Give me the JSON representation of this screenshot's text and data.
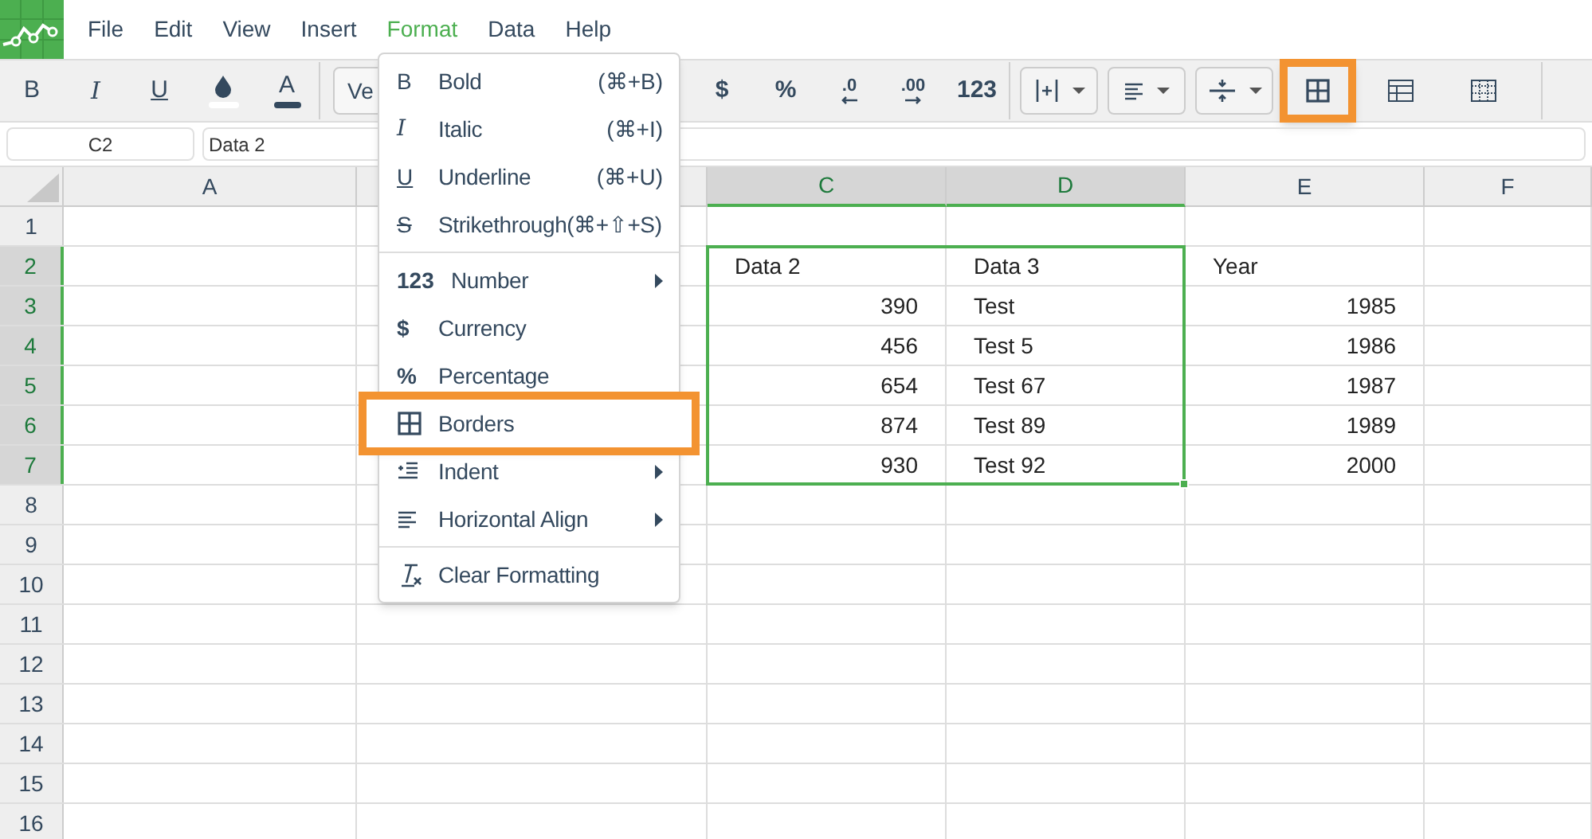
{
  "menu_bar": {
    "items": [
      {
        "label": "File",
        "selected": false
      },
      {
        "label": "Edit",
        "selected": false
      },
      {
        "label": "View",
        "selected": false
      },
      {
        "label": "Insert",
        "selected": false
      },
      {
        "label": "Format",
        "selected": true
      },
      {
        "label": "Data",
        "selected": false
      },
      {
        "label": "Help",
        "selected": false
      }
    ]
  },
  "toolbar": {
    "items": [
      {
        "kind": "bold",
        "label": "B"
      },
      {
        "kind": "italic",
        "label": "I"
      },
      {
        "kind": "underline",
        "label": "U"
      },
      {
        "kind": "fill"
      },
      {
        "kind": "color",
        "label": "A"
      },
      {
        "kind": "select",
        "value": "Ve"
      },
      {
        "kind": "symbol",
        "label": "$"
      },
      {
        "kind": "symbol",
        "label": "%"
      },
      {
        "kind": "decrease",
        "label": ".0"
      },
      {
        "kind": "increase",
        "label": ".00"
      },
      {
        "kind": "symbol",
        "label": "123"
      },
      {
        "kind": "valign"
      },
      {
        "kind": "halign"
      },
      {
        "kind": "split"
      },
      {
        "kind": "borders",
        "highlighted": true
      },
      {
        "kind": "table",
        "highlighted": false
      },
      {
        "kind": "dotted",
        "highlighted": false
      }
    ]
  },
  "formula_bar": {
    "cell": "C2",
    "value": "Data 2"
  },
  "sheet": {
    "columns": [
      {
        "label": "A",
        "selected": false
      },
      {
        "selected": false
      },
      {
        "label": "C",
        "selected": true
      },
      {
        "label": "D",
        "selected": true
      },
      {
        "label": "E",
        "selected": false
      },
      {
        "label": "F",
        "selected": false
      }
    ],
    "rows": [
      {
        "header": "1",
        "selected": false
      },
      {
        "header": "2",
        "selected": true,
        "cells": {
          "C": {
            "kind": "text",
            "text": "Data 2"
          },
          "D": {
            "kind": "text",
            "text": "Data 3"
          },
          "E": {
            "kind": "text",
            "text": "Year"
          }
        }
      },
      {
        "header": "3",
        "selected": true,
        "cells": {
          "C": {
            "kind": "number",
            "text": "390"
          },
          "D": {
            "kind": "text",
            "text": "Test"
          },
          "E": {
            "kind": "number",
            "text": "1985"
          }
        }
      },
      {
        "header": "4",
        "selected": true,
        "cells": {
          "C": {
            "kind": "number",
            "text": "456"
          },
          "D": {
            "kind": "text",
            "text": "Test 5"
          },
          "E": {
            "kind": "number",
            "text": "1986"
          }
        }
      },
      {
        "header": "5",
        "selected": true,
        "cells": {
          "C": {
            "kind": "number",
            "text": "654"
          },
          "D": {
            "kind": "text",
            "text": "Test 67"
          },
          "E": {
            "kind": "number",
            "text": "1987"
          }
        }
      },
      {
        "header": "6",
        "selected": true,
        "cells": {
          "C": {
            "kind": "number",
            "text": "874"
          },
          "D": {
            "kind": "text",
            "text": "Test 89"
          },
          "E": {
            "kind": "number",
            "text": "1989"
          }
        }
      },
      {
        "header": "7",
        "selected": true,
        "cells": {
          "C": {
            "kind": "number",
            "text": "930"
          },
          "D": {
            "kind": "text",
            "text": "Test 92"
          },
          "E": {
            "kind": "number",
            "text": "2000"
          }
        }
      },
      {
        "header": "8",
        "selected": false
      },
      {
        "header": "9",
        "selected": false
      },
      {
        "header": "10",
        "selected": false
      },
      {
        "header": "11",
        "selected": false
      },
      {
        "header": "12",
        "selected": false
      },
      {
        "header": "13",
        "selected": false
      },
      {
        "header": "14",
        "selected": false
      },
      {
        "header": "15",
        "selected": false
      },
      {
        "header": "16",
        "selected": false
      }
    ]
  },
  "format_menu": {
    "items": [
      {
        "kind": "bold",
        "glyph": "B",
        "label": "Bold",
        "shortcut": "(⌘+B)",
        "submenu": false,
        "highlighted": false
      },
      {
        "kind": "italic",
        "glyph": "I",
        "label": "Italic",
        "shortcut": "(⌘+I)",
        "submenu": false,
        "highlighted": false
      },
      {
        "kind": "underline",
        "glyph": "U",
        "label": "Underline",
        "shortcut": "(⌘+U)",
        "submenu": false,
        "highlighted": false
      },
      {
        "kind": "strike",
        "glyph": "S",
        "label": "Strikethrough(⌘+⇧+S)",
        "submenu": false,
        "highlighted": false
      },
      {
        "kind": "separator"
      },
      {
        "kind": "symbol",
        "glyph": "123",
        "label": "Number",
        "submenu": true,
        "highlighted": false
      },
      {
        "kind": "symbol",
        "glyph": "$",
        "label": "Currency",
        "submenu": false,
        "highlighted": false
      },
      {
        "kind": "symbol",
        "glyph": "%",
        "label": "Percentage",
        "submenu": false,
        "highlighted": false
      },
      {
        "kind": "borders",
        "label": "Borders",
        "submenu": false,
        "highlighted": true
      },
      {
        "kind": "indent",
        "label": "Indent",
        "submenu": true,
        "highlighted": false
      },
      {
        "kind": "align",
        "label": "Horizontal Align",
        "submenu": true,
        "highlighted": false
      },
      {
        "kind": "separator"
      },
      {
        "kind": "clear",
        "label": "Clear Formatting",
        "submenu": false,
        "highlighted": false
      }
    ]
  }
}
